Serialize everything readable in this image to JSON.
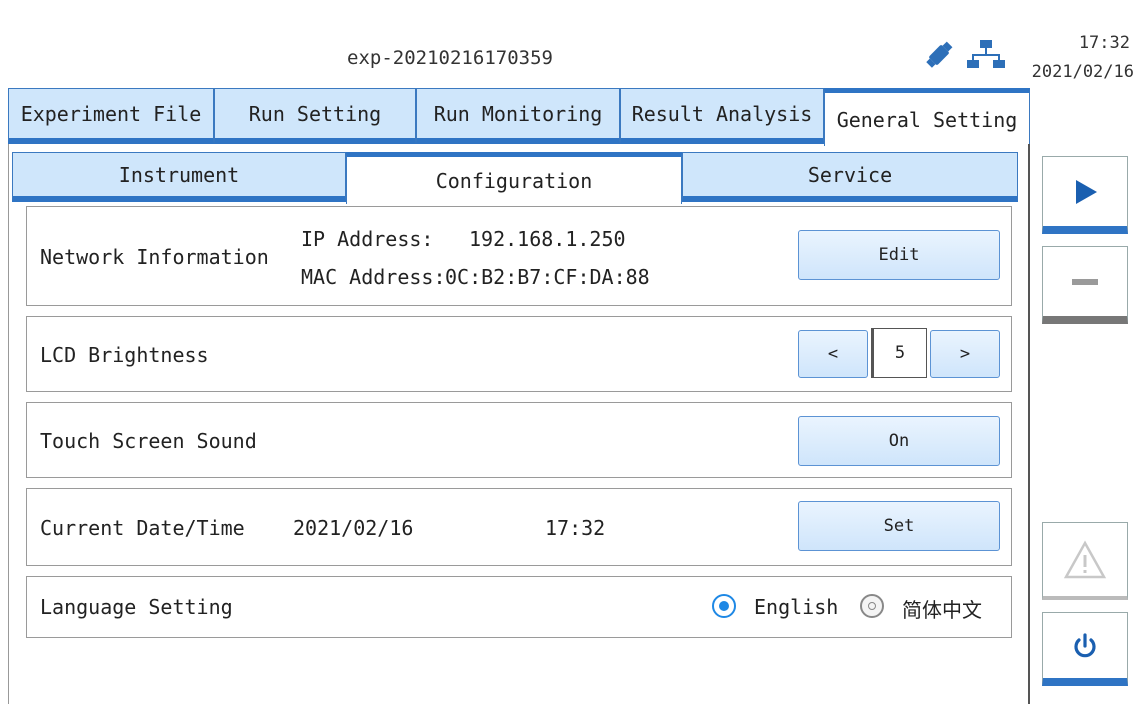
{
  "header": {
    "experiment_name": "exp-20210216170359",
    "time": "17:32",
    "date": "2021/02/16"
  },
  "main_tabs": [
    {
      "label": "Experiment File"
    },
    {
      "label": "Run Setting"
    },
    {
      "label": "Run Monitoring"
    },
    {
      "label": "Result Analysis"
    },
    {
      "label": "General Setting"
    }
  ],
  "sub_tabs": [
    {
      "label": "Instrument"
    },
    {
      "label": "Configuration"
    },
    {
      "label": "Service"
    }
  ],
  "network": {
    "label": "Network Information",
    "ip_label": "IP Address:",
    "ip_value": "192.168.1.250",
    "mac_label": "MAC Address:",
    "mac_value": "0C:B2:B7:CF:DA:88",
    "edit_label": "Edit"
  },
  "brightness": {
    "label": "LCD Brightness",
    "dec_label": "<",
    "value": "5",
    "inc_label": ">"
  },
  "sound": {
    "label": "Touch Screen Sound",
    "toggle_label": "On"
  },
  "datetime": {
    "label": "Current Date/Time",
    "date": "2021/02/16",
    "time": "17:32",
    "set_label": "Set"
  },
  "language": {
    "label": "Language Setting",
    "option_english": "English",
    "option_chinese": "简体中文",
    "selected": "English"
  },
  "colors": {
    "accent": "#2f74c4",
    "tab_bg": "#cfe6fb",
    "radio_selected": "#1e88e5"
  },
  "icons": {
    "usb": "usb-drive-icon",
    "network": "network-icon",
    "run": "play-icon",
    "stop": "minus-icon",
    "warning": "warning-icon",
    "power": "power-icon"
  }
}
